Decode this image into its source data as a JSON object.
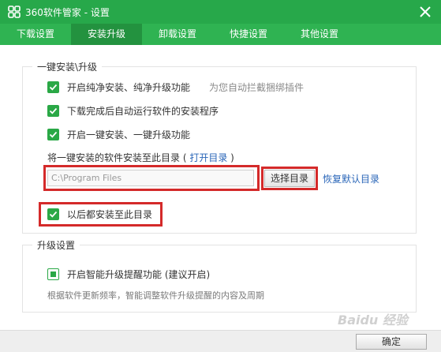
{
  "window": {
    "title": "360软件管家 - 设置"
  },
  "tabs": [
    {
      "label": "下载设置"
    },
    {
      "label": "安装升级"
    },
    {
      "label": "卸载设置"
    },
    {
      "label": "快捷设置"
    },
    {
      "label": "其他设置"
    }
  ],
  "group1": {
    "title": "一键安装\\升级",
    "opt1": {
      "label": "开启纯净安装、纯净升级功能",
      "hint": "为您自动拦截捆绑插件",
      "checked": true
    },
    "opt2": {
      "label": "下载完成后自动运行软件的安装程序",
      "checked": true
    },
    "opt3": {
      "label": "开启一键安装、一键升级功能",
      "checked": true
    },
    "dir_label_prefix": "将一键安装的软件安装至此目录 (",
    "open_dir_link": "打开目录",
    "dir_label_suffix": ")",
    "path_value": "C:\\Program Files",
    "choose_button": "选择目录",
    "restore_link": "恢复默认目录",
    "opt4": {
      "label": "以后都安装至此目录",
      "checked": true
    }
  },
  "group2": {
    "title": "升级设置",
    "opt1": {
      "label": "开启智能升级提醒功能 (建议开启)",
      "checked": true
    },
    "description": "根据软件更新频率，智能调整软件升级提醒的内容及周期"
  },
  "footer": {
    "ok_button": "确定"
  },
  "watermark": "Baidu 经验",
  "colors": {
    "titlebar": "#27a84a",
    "tabbar": "#2fb352",
    "tab_active": "#23923f",
    "checkbox": "#2aa846",
    "link": "#2a66b8",
    "highlight": "#d42a2a"
  }
}
